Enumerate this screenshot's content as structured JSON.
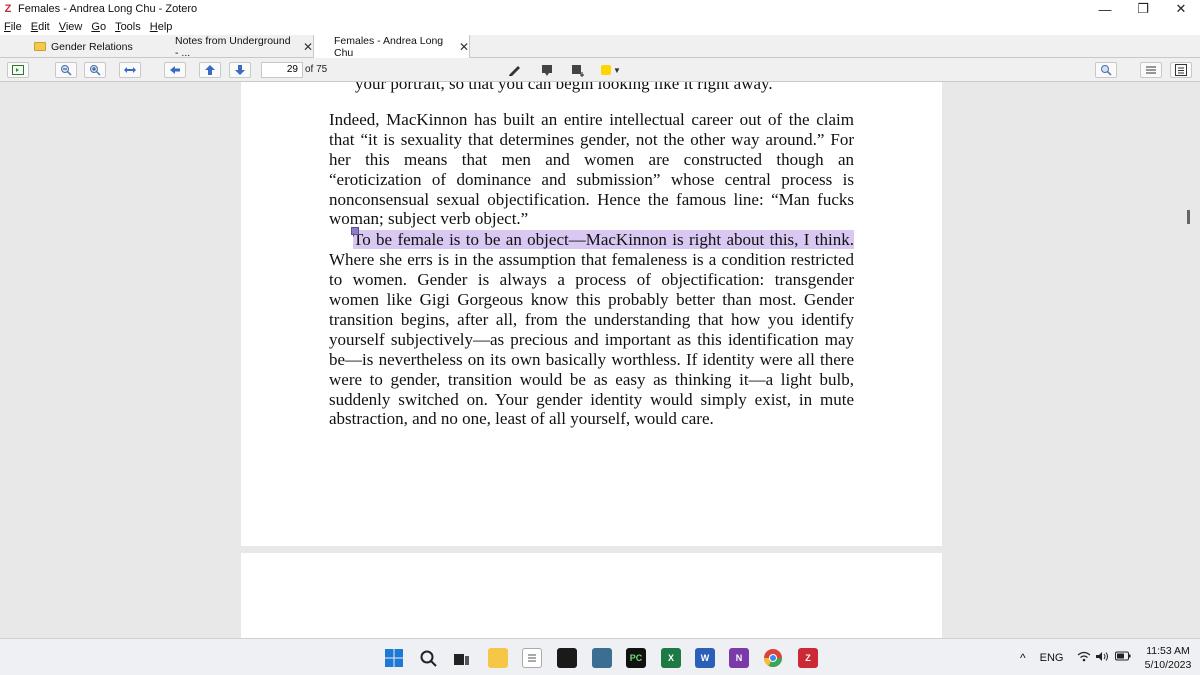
{
  "window": {
    "title": "Females - Andrea Long Chu - Zotero",
    "logo_letter": "Z",
    "minimize": "—",
    "restore": "❐",
    "close": "✕"
  },
  "menu": {
    "items": [
      {
        "u": "F",
        "rest": "ile"
      },
      {
        "u": "E",
        "rest": "dit"
      },
      {
        "u": "V",
        "rest": "iew"
      },
      {
        "u": "G",
        "rest": "o"
      },
      {
        "u": "T",
        "rest": "ools"
      },
      {
        "u": "H",
        "rest": "elp"
      }
    ]
  },
  "tabs": [
    {
      "label": "Gender Relations"
    },
    {
      "label": "Notes from Underground - ...",
      "close": "✕"
    },
    {
      "label": "Females - Andrea Long Chu",
      "close": "✕"
    }
  ],
  "toolbar": {
    "page_current": "29",
    "page_total": "of 75",
    "highlight_color": "#ffd400"
  },
  "document": {
    "cut_line": "your portrait, so that you can begin looking like it right away.",
    "para1": [
      "Indeed, MacKinnon has built an entire intellectual career out of the claim",
      "that “it is sexuality that determines gender, not the other way around.” For",
      "her this means that men and women are constructed though an",
      "“eroticization of dominance and submission” whose central process is",
      "nonconsensual sexual objectification. Hence the famous line: “Man fucks",
      "woman; subject verb object.”"
    ],
    "highlighted": "To be female is to be an object—MacKinnon is right about this, I think.",
    "para2": [
      "Where she errs is in the assumption that femaleness is a condition restricted",
      "to women. Gender is always a process of objectification: transgender",
      "women like Gigi Gorgeous know this probably better than most. Gender",
      "transition begins, after all, from the understanding that how you identify",
      "yourself subjectively—as precious and important as this identification may",
      "be—is nevertheless on its own basically worthless. If identity were all there",
      "were to gender, transition would be as easy as thinking it—a light bulb,",
      "suddenly switched on. Your gender identity would simply exist, in mute"
    ],
    "last_line": "abstraction, and no one, least of all yourself, would care.",
    "highlight_color": "#d9c9f2"
  },
  "taskbar": {
    "language": "ENG",
    "time": "11:53 AM",
    "date": "5/10/2023",
    "tray_up": "^"
  }
}
